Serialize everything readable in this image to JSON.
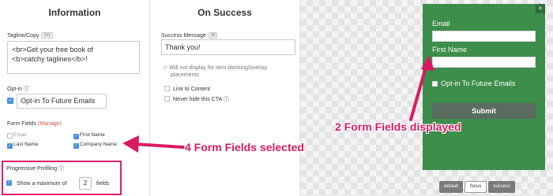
{
  "information": {
    "title": "Information",
    "tagline_label": "Tagline/Copy",
    "tagline_count": "101",
    "tagline_line1": "<br>Get your free book of",
    "tagline_line2": "<b>catchy taglines</b>!",
    "optin_label": "Opt-in",
    "optin_value": "Opt-in To Future Emails",
    "form_fields_label": "Form Fields",
    "form_fields_manage": "Manage",
    "fields": [
      {
        "label": "Email",
        "checked": true,
        "disabled": true
      },
      {
        "label": "First Name",
        "checked": true,
        "disabled": false
      },
      {
        "label": "Last Name",
        "checked": true,
        "disabled": false
      },
      {
        "label": "Company Name",
        "checked": true,
        "disabled": false
      }
    ],
    "progressive_label": "Progressive Profiling",
    "progressive_prefix": "Show a maximum of",
    "progressive_value": "2",
    "progressive_suffix": "fields"
  },
  "success": {
    "title": "On Success",
    "message_label": "Success Message",
    "message_count": "30",
    "message_value": "Thank you!",
    "note_line1": "Will not display for item blocking/overlay",
    "note_line2": "placements",
    "link_to_content": "Link to Content",
    "never_hide": "Never hide this CTA"
  },
  "preview": {
    "close": "×",
    "email_label": "Email",
    "first_name_label": "First Name",
    "optin_text": "Opt-in To Future Emails",
    "submit_label": "Submit",
    "tabs": [
      "default",
      "focus",
      "success"
    ],
    "active_tab": "focus"
  },
  "annotations": {
    "selected": "4 Form Fields selected",
    "displayed": "2 Form Fields displayed"
  },
  "colors": {
    "accent": "#4a90e2",
    "annotation": "#d81b60",
    "form_bg": "#3d8d4b",
    "submit_bg": "#5a6b5f"
  }
}
